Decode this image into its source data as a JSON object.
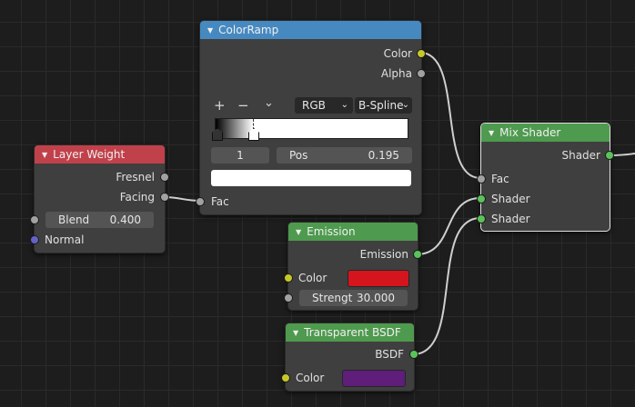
{
  "nodes": {
    "colorramp": {
      "title": "ColorRamp",
      "outputs": [
        "Color",
        "Alpha"
      ],
      "toolbar": {
        "add": "+",
        "remove": "−",
        "menu": "⌄"
      },
      "color_mode": "RGB",
      "interpolation": "B-Spline",
      "stop_index": "1",
      "pos_label": "Pos",
      "pos_value": "0.195",
      "input": "Fac"
    },
    "layer_weight": {
      "title": "Layer Weight",
      "outputs": [
        "Fresnel",
        "Facing"
      ],
      "blend_label": "Blend",
      "blend_value": "0.400",
      "normal_label": "Normal"
    },
    "mix_shader": {
      "title": "Mix Shader",
      "output": "Shader",
      "inputs": [
        "Fac",
        "Shader",
        "Shader"
      ]
    },
    "emission": {
      "title": "Emission",
      "output": "Emission",
      "color_label": "Color",
      "color_value": "#d4151d",
      "strength_label": "Strengt",
      "strength_value": "30.000"
    },
    "transparent": {
      "title": "Transparent BSDF",
      "output": "BSDF",
      "color_label": "Color",
      "color_value": "#5e1e7a"
    }
  },
  "colors": {
    "colorramp_header": "#4689c0",
    "layer_weight_header": "#c1414b",
    "shader_header": "#4e9a4e",
    "socket_color": "#c7c729",
    "socket_float": "#a1a1a1",
    "socket_shader": "#5ac35a",
    "socket_vector": "#6363c7"
  }
}
